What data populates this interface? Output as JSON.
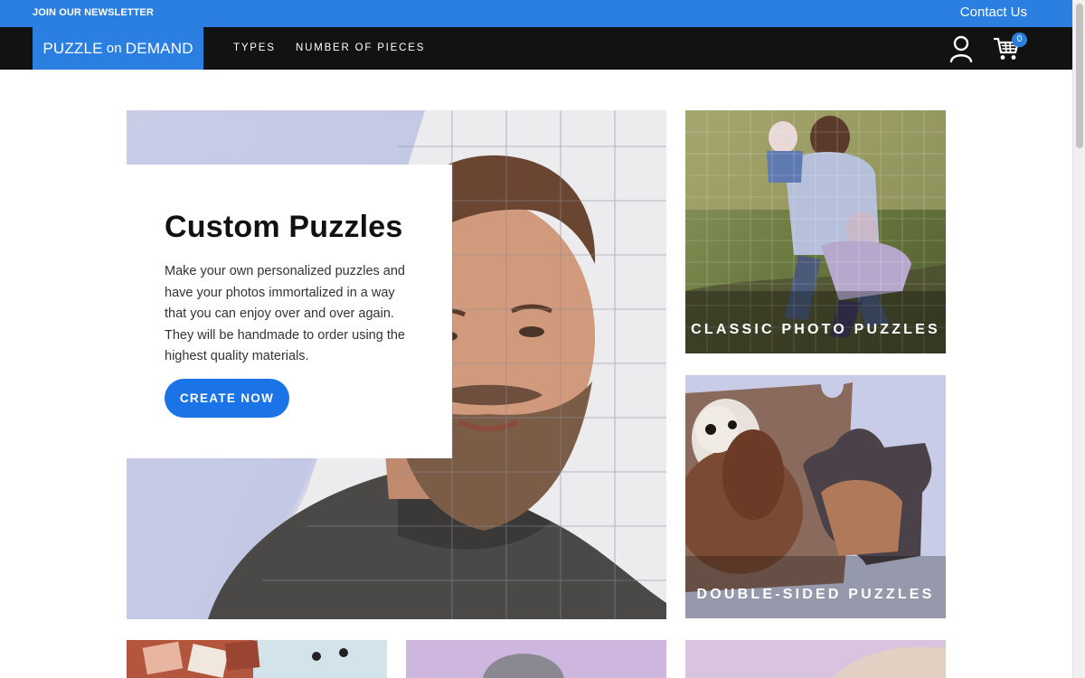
{
  "topbar": {
    "newsletter_label": "JOIN OUR NEWSLETTER",
    "contact_label": "Contact Us",
    "bg_color": "#2b7fe0"
  },
  "navbar": {
    "logo_main": "PUZZLE",
    "logo_on": "on",
    "logo_end": "DEMAND",
    "links": [
      {
        "label": "TYPES"
      },
      {
        "label": "NUMBER OF PIECES"
      }
    ],
    "user_icon": "user-icon",
    "cart_icon": "cart-icon",
    "cart_count": "0"
  },
  "hero": {
    "title": "Custom Puzzles",
    "text": "Make your own personalized puzzles and have your photos immortalized in a way that you can enjoy over and over again. They will be handmade to order using the highest quality materials.",
    "cta_label": "CREATE NOW",
    "accent_color": "#1a74e8"
  },
  "tiles": [
    {
      "label": "CLASSIC PHOTO PUZZLES"
    },
    {
      "label": "DOUBLE-SIDED PUZZLES"
    }
  ]
}
